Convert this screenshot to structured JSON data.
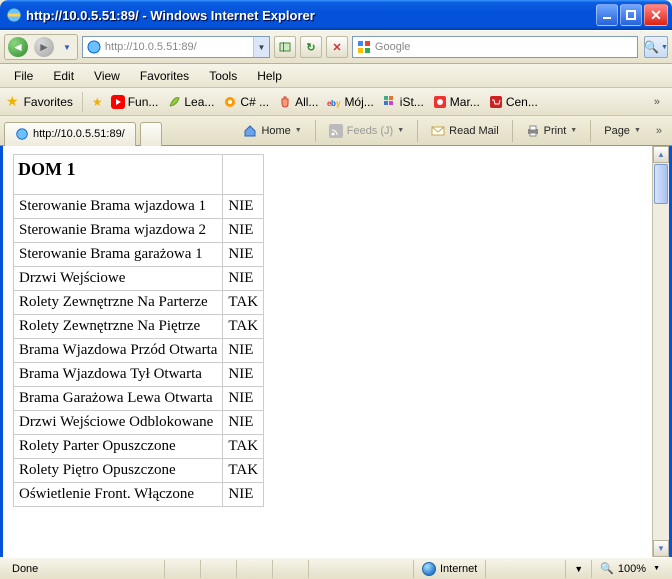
{
  "title_prefix": "http://10.0.5.51:89/ - Windows Internet Explorer",
  "address": "http://10.0.5.51:89/",
  "search_placeholder": "Google",
  "menu": {
    "file": "File",
    "edit": "Edit",
    "view": "View",
    "favorites": "Favorites",
    "tools": "Tools",
    "help": "Help"
  },
  "favbar": {
    "label": "Favorites",
    "items": [
      {
        "label": "Fun..."
      },
      {
        "label": "Lea..."
      },
      {
        "label": "C# ..."
      },
      {
        "label": "All..."
      },
      {
        "label": "Mój..."
      },
      {
        "label": "iSt..."
      },
      {
        "label": "Mar..."
      },
      {
        "label": "Cen..."
      }
    ]
  },
  "tab_label": "http://10.0.5.51:89/",
  "cmd": {
    "home": "Home",
    "feeds": "Feeds (J)",
    "readmail": "Read Mail",
    "print": "Print",
    "page": "Page"
  },
  "page_title": "DOM 1",
  "rows": [
    {
      "n": "Sterowanie Brama wjazdowa 1",
      "v": "NIE"
    },
    {
      "n": "Sterowanie Brama wjazdowa 2",
      "v": "NIE"
    },
    {
      "n": "Sterowanie Brama garażowa 1",
      "v": "NIE"
    },
    {
      "n": "Drzwi Wejściowe",
      "v": "NIE"
    },
    {
      "n": "Rolety Zewnętrzne Na Parterze",
      "v": "TAK"
    },
    {
      "n": "Rolety Zewnętrzne Na Piętrze",
      "v": "TAK"
    },
    {
      "n": "Brama Wjazdowa Przód Otwarta",
      "v": "NIE"
    },
    {
      "n": "Brama Wjazdowa Tył Otwarta",
      "v": "NIE"
    },
    {
      "n": "Brama Garażowa Lewa Otwarta",
      "v": "NIE"
    },
    {
      "n": "Drzwi Wejściowe Odblokowane",
      "v": "NIE"
    },
    {
      "n": "Rolety Parter Opuszczone",
      "v": "TAK"
    },
    {
      "n": "Rolety Piętro Opuszczone",
      "v": "TAK"
    },
    {
      "n": "Oświetlenie Front. Włączone",
      "v": "NIE"
    }
  ],
  "status": {
    "done": "Done",
    "zone": "Internet",
    "zoom": "100%"
  }
}
